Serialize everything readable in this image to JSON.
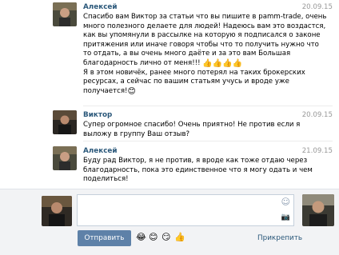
{
  "messages": [
    {
      "author": "Алексей",
      "date": "20.09.15",
      "lines": [
        "Спасибо вам Виктор за статьи что вы пишите в pamm-trade, очень",
        "много полезного делаете для людей! Надеюсь вам это воздастся,",
        "как вы упомянули в рассылке на которую я подписался о законе",
        "притяжения или иначе говоря чтобы что то получить нужно что",
        "то отдать, а вы очень много даёте и за это вам Большая",
        "благодарность лично от меня!!!",
        "Я в этом новичёк, ранее много потерял на таких брокерских",
        "ресурсах, а сейчас по вашим статьям учусь и вроде уже",
        "получается!"
      ]
    },
    {
      "author": "Виктор",
      "date": "20.09.15",
      "lines": [
        "Супер огромное спасибо! Очень приятно! Не против если я",
        "выложу в группу Ваш отзыв?"
      ]
    },
    {
      "author": "Алексей",
      "date": "21.09.15",
      "lines": [
        "Буду рад Виктор, я не против, я вроде как тоже отдаю через",
        "благодарность, пока это единственное что я могу одать и чем",
        "поделиться!"
      ]
    }
  ],
  "composer": {
    "send_label": "Отправить",
    "attach_label": "Прикрепить",
    "quick_emojis": [
      "😂",
      "😊",
      "😏",
      "👍"
    ]
  },
  "icons": {
    "thumbs": "👍",
    "smile": "😊",
    "emoji_picker": "☺",
    "camera": "📷"
  },
  "colors": {
    "author": "#2b587a",
    "date": "#999999",
    "button": "#5e81a8",
    "composer_bg": "#f2f3f5"
  }
}
